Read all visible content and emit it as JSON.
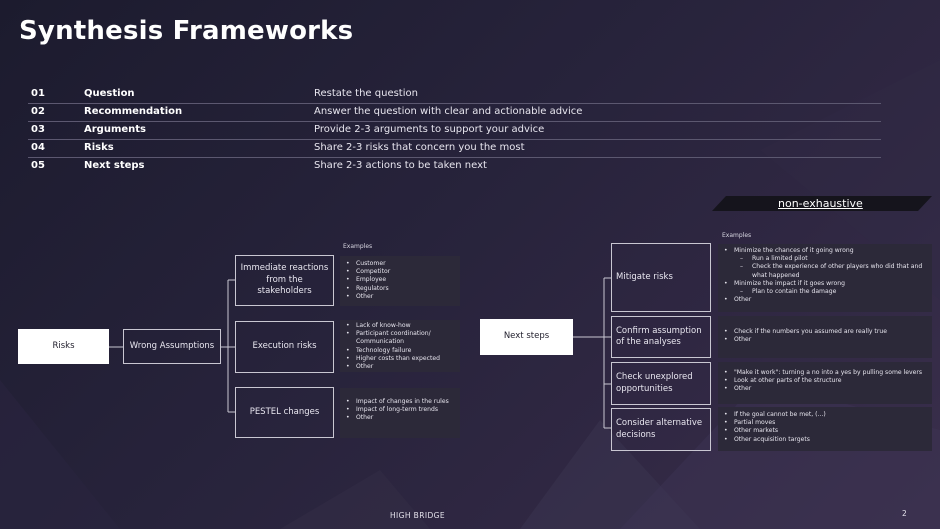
{
  "title": "Synthesis Frameworks",
  "framework_rows": [
    {
      "num": "01",
      "label": "Question",
      "desc": "Restate the question"
    },
    {
      "num": "02",
      "label": "Recommendation",
      "desc": "Answer the question with clear and actionable advice"
    },
    {
      "num": "03",
      "label": "Arguments",
      "desc": "Provide 2-3 arguments to support your advice"
    },
    {
      "num": "04",
      "label": "Risks",
      "desc": "Share 2-3 risks that concern you the most"
    },
    {
      "num": "05",
      "label": "Next steps",
      "desc": "Share 2-3 actions to be taken next"
    }
  ],
  "banner": "non-exhaustive",
  "risks_tree": {
    "root": "Risks",
    "level1": "Wrong Assumptions",
    "examples_label": "Examples",
    "branches": [
      {
        "label": "Immediate reactions from the stakeholders",
        "examples": [
          "Customer",
          "Competitor",
          "Employee",
          "Regulators",
          "Other"
        ]
      },
      {
        "label": "Execution risks",
        "examples": [
          "Lack of know-how",
          "Participant coordination/ Communication",
          "Technology failure",
          "Higher costs than expected",
          "Other"
        ]
      },
      {
        "label": "PESTEL changes",
        "examples": [
          "Impact of changes in the rules",
          "Impact of long-term trends",
          "Other"
        ]
      }
    ]
  },
  "next_steps_tree": {
    "root": "Next steps",
    "examples_label": "Examples",
    "branches": [
      {
        "label": "Mitigate risks",
        "examples": [
          {
            "text": "Minimize the chances of it going wrong",
            "sub": false
          },
          {
            "text": "Run a limited pilot",
            "sub": true
          },
          {
            "text": "Check the experience of other players who did that and what happened",
            "sub": true
          },
          {
            "text": "Minimize the impact if it goes wrong",
            "sub": false
          },
          {
            "text": "Plan to contain the damage",
            "sub": true
          },
          {
            "text": "Other",
            "sub": false
          }
        ]
      },
      {
        "label": "Confirm assumption of the analyses",
        "examples": [
          {
            "text": "Check if the numbers you assumed are really true",
            "sub": false
          },
          {
            "text": "Other",
            "sub": false
          }
        ]
      },
      {
        "label": "Check unexplored opportunities",
        "examples": [
          {
            "text": "\"Make it work\": turning a no into a yes by pulling some levers",
            "sub": false
          },
          {
            "text": "Look at other parts of the structure",
            "sub": false
          },
          {
            "text": "Other",
            "sub": false
          }
        ]
      },
      {
        "label": "Consider alternative decisions",
        "examples": [
          {
            "text": "If the goal cannot be met, (...)",
            "sub": false
          },
          {
            "text": "Partial moves",
            "sub": false
          },
          {
            "text": "Other markets",
            "sub": false
          },
          {
            "text": "Other acquisition targets",
            "sub": false
          }
        ]
      }
    ]
  },
  "footer": "HIGH BRIDGE",
  "page_number": "2",
  "colors": {
    "background": "#26223a",
    "panel": "#2c2939",
    "accent_white": "#ffffff"
  }
}
